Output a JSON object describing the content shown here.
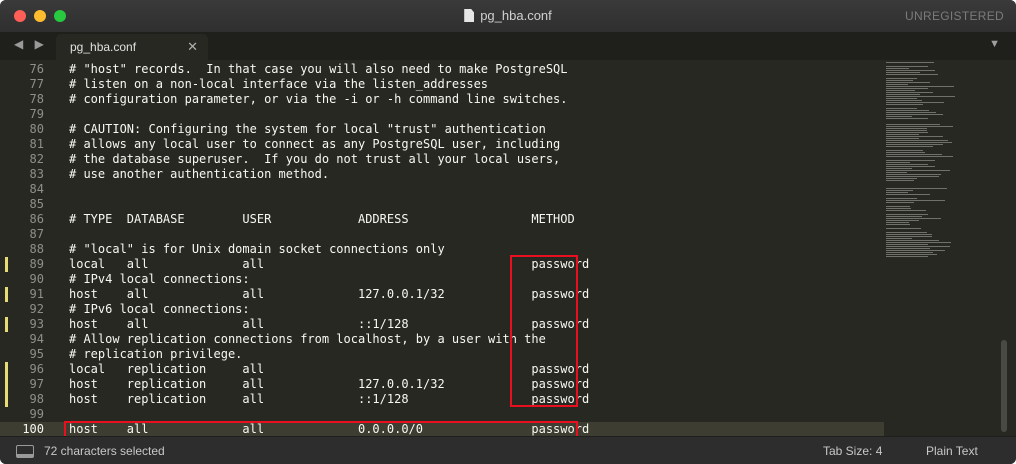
{
  "window": {
    "title": "pg_hba.conf",
    "unregistered": "UNREGISTERED"
  },
  "tabbar": {
    "nav_arrows": "◀ ▶",
    "tab_label": "pg_hba.conf",
    "tab_close": "✕",
    "menu_glyph": "▼"
  },
  "editor": {
    "lines": [
      {
        "n": "76",
        "text": "# \"host\" records.  In that case you will also need to make PostgreSQL"
      },
      {
        "n": "77",
        "text": "# listen on a non-local interface via the listen_addresses"
      },
      {
        "n": "78",
        "text": "# configuration parameter, or via the -i or -h command line switches."
      },
      {
        "n": "79",
        "text": ""
      },
      {
        "n": "80",
        "text": "# CAUTION: Configuring the system for local \"trust\" authentication"
      },
      {
        "n": "81",
        "text": "# allows any local user to connect as any PostgreSQL user, including"
      },
      {
        "n": "82",
        "text": "# the database superuser.  If you do not trust all your local users,"
      },
      {
        "n": "83",
        "text": "# use another authentication method."
      },
      {
        "n": "84",
        "text": ""
      },
      {
        "n": "85",
        "text": ""
      },
      {
        "n": "86",
        "text": "# TYPE  DATABASE        USER            ADDRESS                 METHOD"
      },
      {
        "n": "87",
        "text": ""
      },
      {
        "n": "88",
        "text": "# \"local\" is for Unix domain socket connections only"
      },
      {
        "n": "89",
        "text": "local   all             all                                     password"
      },
      {
        "n": "90",
        "text": "# IPv4 local connections:"
      },
      {
        "n": "91",
        "text": "host    all             all             127.0.0.1/32            password"
      },
      {
        "n": "92",
        "text": "# IPv6 local connections:"
      },
      {
        "n": "93",
        "text": "host    all             all             ::1/128                 password"
      },
      {
        "n": "94",
        "text": "# Allow replication connections from localhost, by a user with the"
      },
      {
        "n": "95",
        "text": "# replication privilege."
      },
      {
        "n": "96",
        "text": "local   replication     all                                     password"
      },
      {
        "n": "97",
        "text": "host    replication     all             127.0.0.1/32            password"
      },
      {
        "n": "98",
        "text": "host    replication     all             ::1/128                 password"
      },
      {
        "n": "99",
        "text": ""
      },
      {
        "n": "100",
        "text": "host    all             all             0.0.0.0/0               password"
      }
    ],
    "modified_lines": [
      "89",
      "91",
      "93",
      "96",
      "97",
      "98"
    ],
    "current_line": "100"
  },
  "status": {
    "selection": "72 characters selected",
    "tab_size": "Tab Size: 4",
    "syntax": "Plain Text"
  },
  "colors": {
    "background": "#272822",
    "highlight_box": "#e8101d",
    "modified_marker": "#e6db74"
  }
}
